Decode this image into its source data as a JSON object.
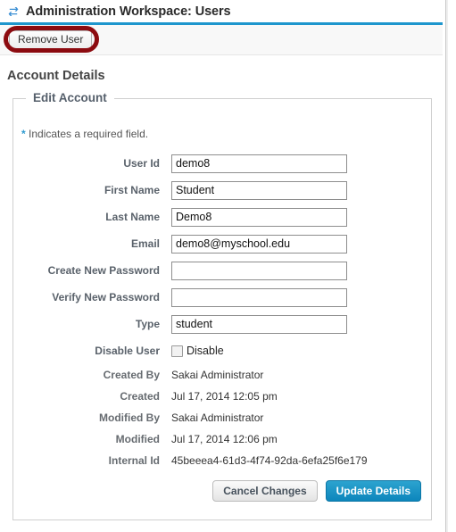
{
  "window": {
    "title": "Administration Workspace: Users",
    "title_icon": "sync-arrows-icon"
  },
  "toolbar": {
    "remove_user_label": "Remove User",
    "annotation_color": "#8c0b10"
  },
  "content": {
    "heading": "Account Details",
    "fieldset_legend": "Edit Account",
    "required_note_star": "*",
    "required_note_text": " Indicates a required field."
  },
  "form": {
    "fields": [
      {
        "label": "User Id",
        "value": "demo8",
        "type": "text"
      },
      {
        "label": "First Name",
        "value": "Student",
        "type": "text"
      },
      {
        "label": "Last Name",
        "value": "Demo8",
        "type": "text"
      },
      {
        "label": "Email",
        "value": "demo8@myschool.edu",
        "type": "text"
      },
      {
        "label": "Create New Password",
        "value": "",
        "type": "password"
      },
      {
        "label": "Verify New Password",
        "value": "",
        "type": "password"
      },
      {
        "label": "Type",
        "value": "student",
        "type": "text"
      }
    ],
    "disable_user": {
      "label": "Disable User",
      "checkbox_label": "Disable",
      "checked": false
    },
    "readonly_fields": [
      {
        "label": "Created By",
        "value": "Sakai Administrator"
      },
      {
        "label": "Created",
        "value": "Jul 17, 2014 12:05 pm"
      },
      {
        "label": "Modified By",
        "value": "Sakai Administrator"
      },
      {
        "label": "Modified",
        "value": "Jul 17, 2014 12:06 pm"
      },
      {
        "label": "Internal Id",
        "value": "45beeea4-61d3-4f74-92da-6efa25f6e179"
      }
    ]
  },
  "actions": {
    "cancel_label": "Cancel Changes",
    "update_label": "Update Details",
    "update_color": "#0d86bc"
  }
}
